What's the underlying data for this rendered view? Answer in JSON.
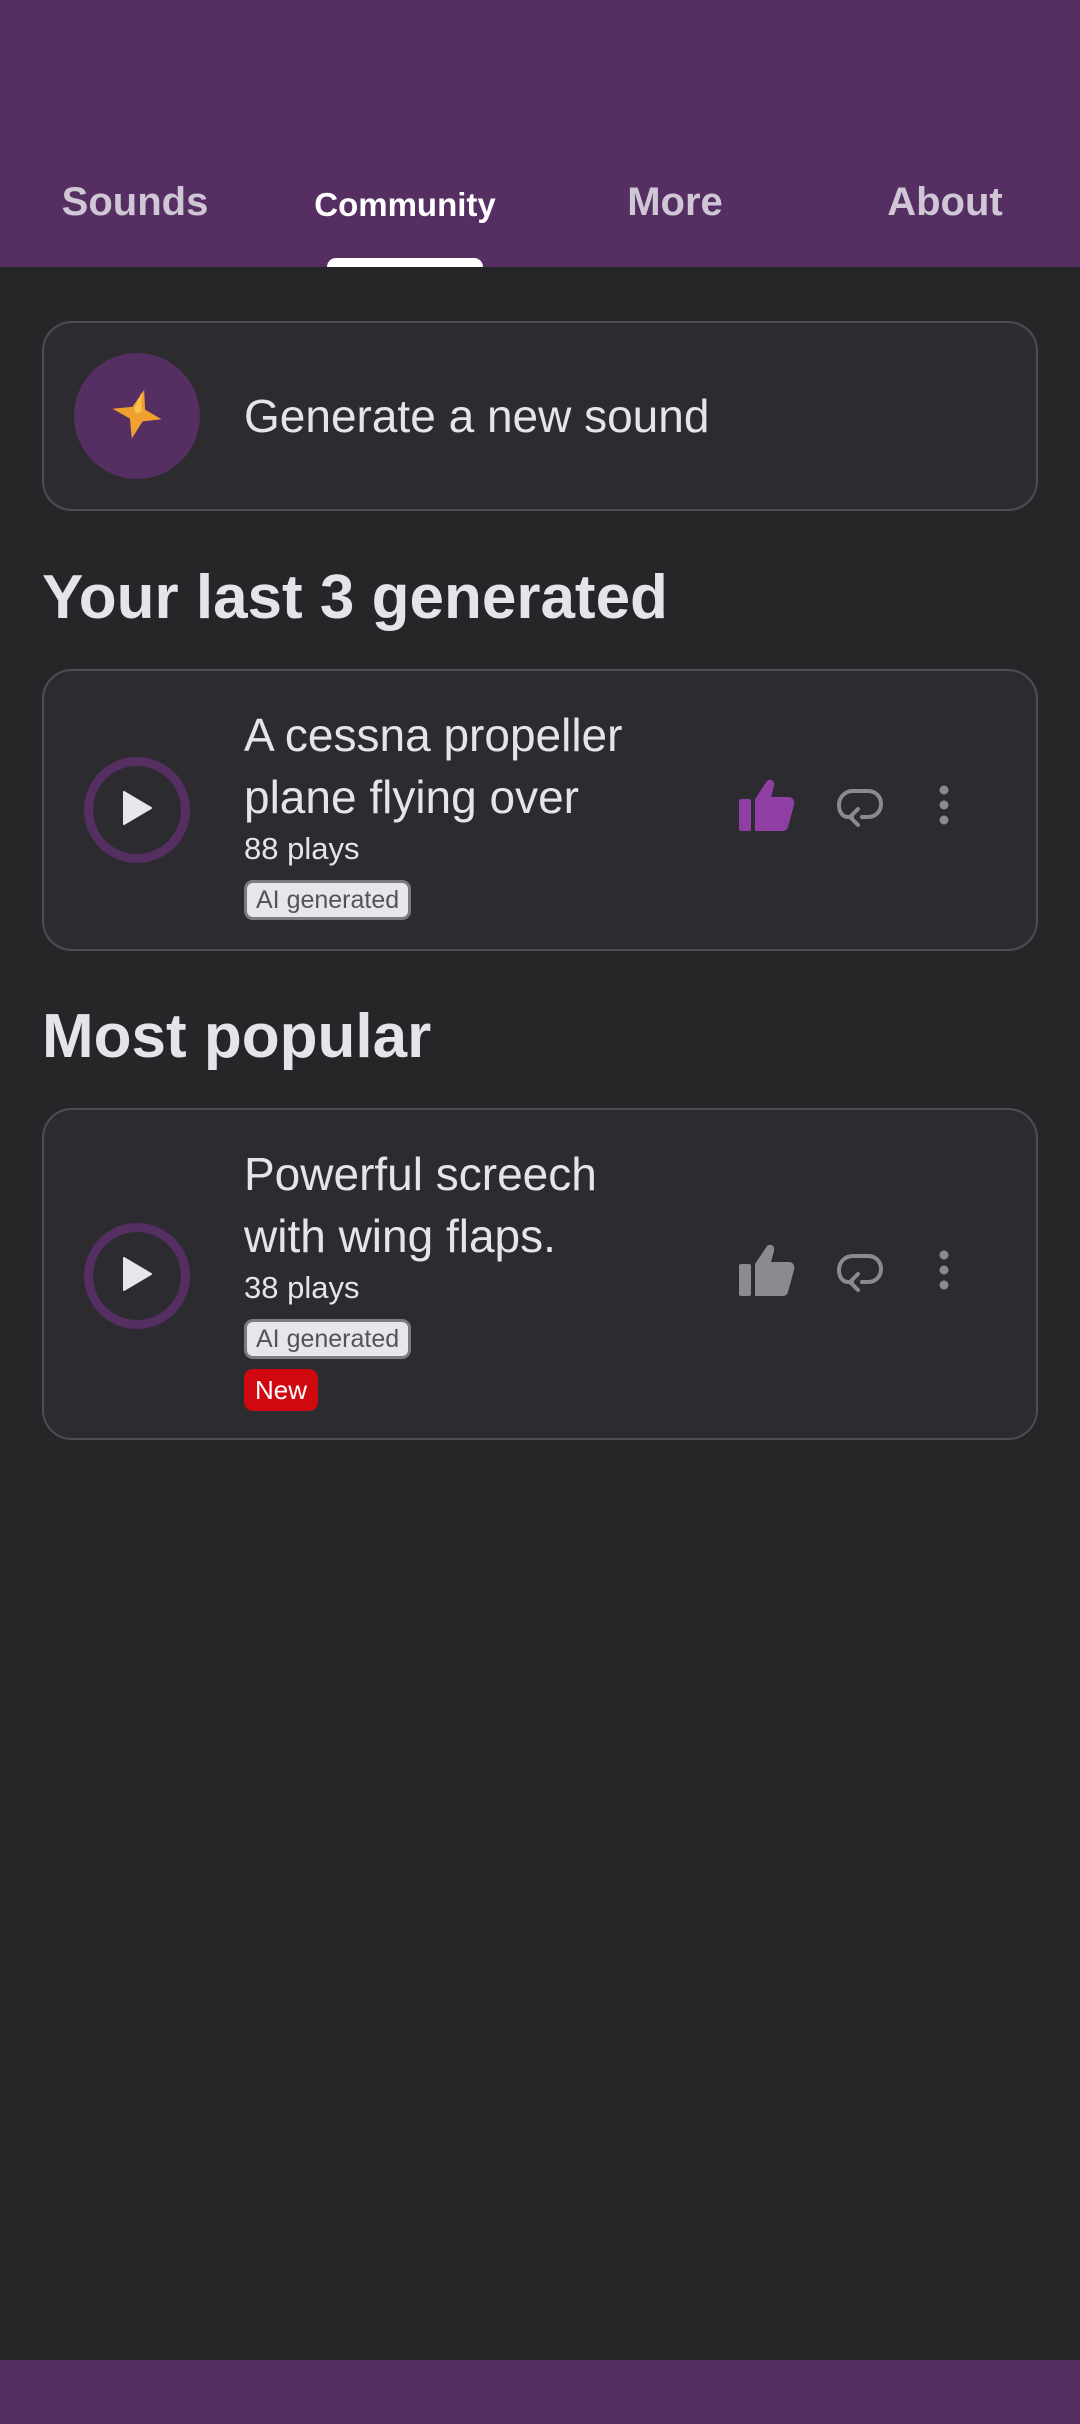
{
  "tabs": [
    {
      "label": "Sounds"
    },
    {
      "label": "Community"
    },
    {
      "label": "More"
    },
    {
      "label": "About"
    }
  ],
  "generate": {
    "label": "Generate a new sound",
    "icon": "sparkle-icon"
  },
  "recent": {
    "title": "Your last 3 generated",
    "items": [
      {
        "title": "A cessna propeller plane flying over",
        "plays": "88 plays",
        "badge": "AI generated"
      }
    ]
  },
  "popular": {
    "title": "Most popular",
    "items": [
      {
        "title": "Powerful screech with wing flaps.",
        "plays": "38 plays",
        "badge": "AI generated",
        "new_badge": "New"
      }
    ]
  },
  "colors": {
    "brand": "#552e62",
    "background": "#262628",
    "card": "#2c2c30",
    "liked": "#8f3fa3",
    "new": "#d0080f",
    "sparkle": "#f0a030"
  }
}
